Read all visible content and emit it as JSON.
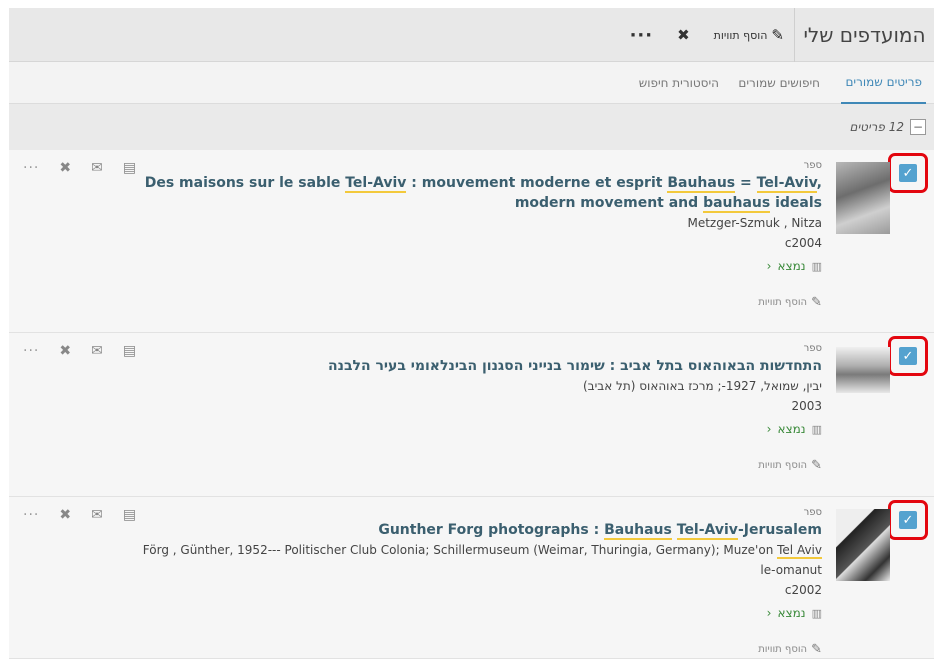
{
  "header": {
    "title": "המועדפים שלי",
    "add_tags_label": "הוסף תוויות",
    "pencil_glyph": "✎",
    "unpin_glyph": "✖",
    "more_glyph": "···"
  },
  "tabs": [
    {
      "label": "פריטים שמורים",
      "active": true
    },
    {
      "label": "חיפושים שמורים",
      "active": false
    },
    {
      "label": "היסטורית חיפוש",
      "active": false
    }
  ],
  "count": {
    "text": "12 פריטים",
    "minus_glyph": "−"
  },
  "colors": {
    "accent": "#3f88b7",
    "checkbox": "#54a2cf",
    "highlight_box": "#e3060f",
    "title": "#3b5f6f",
    "available": "#3a8a3a"
  },
  "icons": {
    "check": "✓",
    "unpin": "✖",
    "email": "✉",
    "doc": "▤",
    "more": "···",
    "book": "▥",
    "chevron": "‹",
    "pencil": "✎"
  },
  "items": [
    {
      "type": "ספר",
      "title_parts": [
        "Des maisons sur le sable ",
        "Tel-Aviv",
        " : mouvement moderne et esprit ",
        "Bauhaus",
        " = ",
        "Tel-Aviv",
        ", modern movement and ",
        "bauhaus",
        " ideals"
      ],
      "author": "Metzger-Szmuk , Nitza",
      "year": "c2004",
      "availability": "נמצא",
      "add_tags": "הוסף תוויות"
    },
    {
      "type": "ספר",
      "title_parts": [
        "התחדשות הבאוהאוס בתל אביב : שימור בנייני הסגנון הבינלאומי בעיר הלבנה"
      ],
      "author": "יבין, שמואל, 1927-; מרכז באוהאוס (תל אביב)",
      "year": "2003",
      "availability": "נמצא",
      "add_tags": "הוסף תוויות"
    },
    {
      "type": "ספר",
      "title_parts": [
        "Gunther Forg photographs : ",
        "Bauhaus",
        " ",
        "Tel-Aviv",
        "-Jerusalem"
      ],
      "author_parts": [
        "Förg , Günther, 1952--- Politischer Club Colonia; Schillermuseum (Weimar, Thuringia, Germany); Muze'on ",
        "Tel Aviv",
        " le-omanut"
      ],
      "year": "c2002",
      "availability": "נמצא",
      "add_tags": "הוסף תוויות"
    }
  ]
}
